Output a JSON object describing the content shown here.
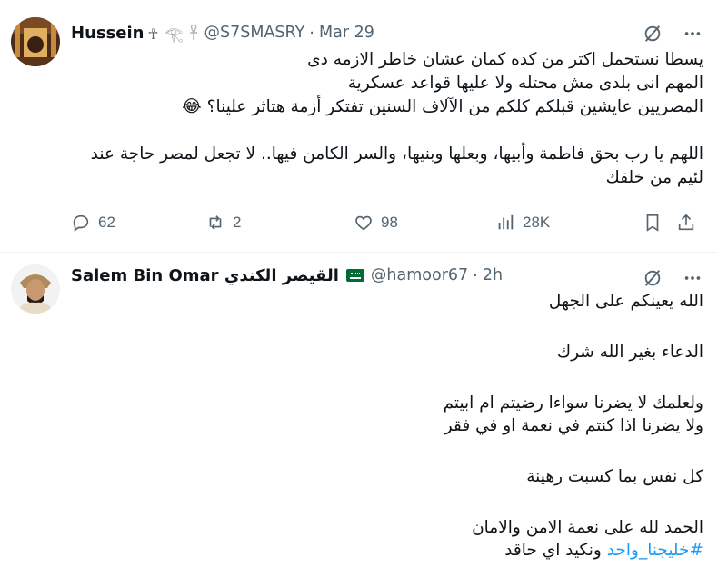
{
  "tweet1": {
    "name": "Hussein",
    "name_extra": "☥ 𓂀 𓋹",
    "handle": "@S7SMASRY",
    "separator": "·",
    "time": "Mar 29",
    "lines": [
      "يسطا نستحمل اكتر من كده كمان عشان خاطر الازمه دى",
      "المهم انى بلدى مش محتله ولا عليها قواعد عسكرية",
      "المصريين عايشين قبلكم كلكم من الآلاف السنين تفتكر أزمة هتاثر علينا؟ 😂",
      "اللهم يا رب بحق فاطمة وأبيها، وبعلها وبنيها، والسر الكامن فيها.. لا تجعل لمصر حاجة عند",
      "لئيم من خلقك"
    ],
    "replies": "62",
    "reposts": "2",
    "likes": "98",
    "views": "28K"
  },
  "tweet2": {
    "name": "Salem Bin Omar القيصر الكندي",
    "handle": "@hamoor67",
    "separator": "·",
    "time": "2h",
    "lines": [
      "الله يعينكم على الجهل",
      "الدعاء بغير الله شرك",
      "ولعلمك لا يضرنا سواءا رضيتم ام ابيتم",
      "ولا يضرنا اذا كنتم في نعمة او في فقر",
      "كل نفس بما كسبت رهينة",
      "الحمد لله على نعمة الامن والامان",
      "#خليجنا_واحد",
      "ونكيد اي حاقد"
    ]
  },
  "colors": {
    "text": "#0f1419",
    "muted": "#536471",
    "link": "#1d9bf0",
    "border": "#eff3f4"
  },
  "icons": [
    "grok-icon",
    "more-icon",
    "reply-icon",
    "repost-icon",
    "like-icon",
    "views-icon",
    "bookmark-icon",
    "share-icon"
  ]
}
